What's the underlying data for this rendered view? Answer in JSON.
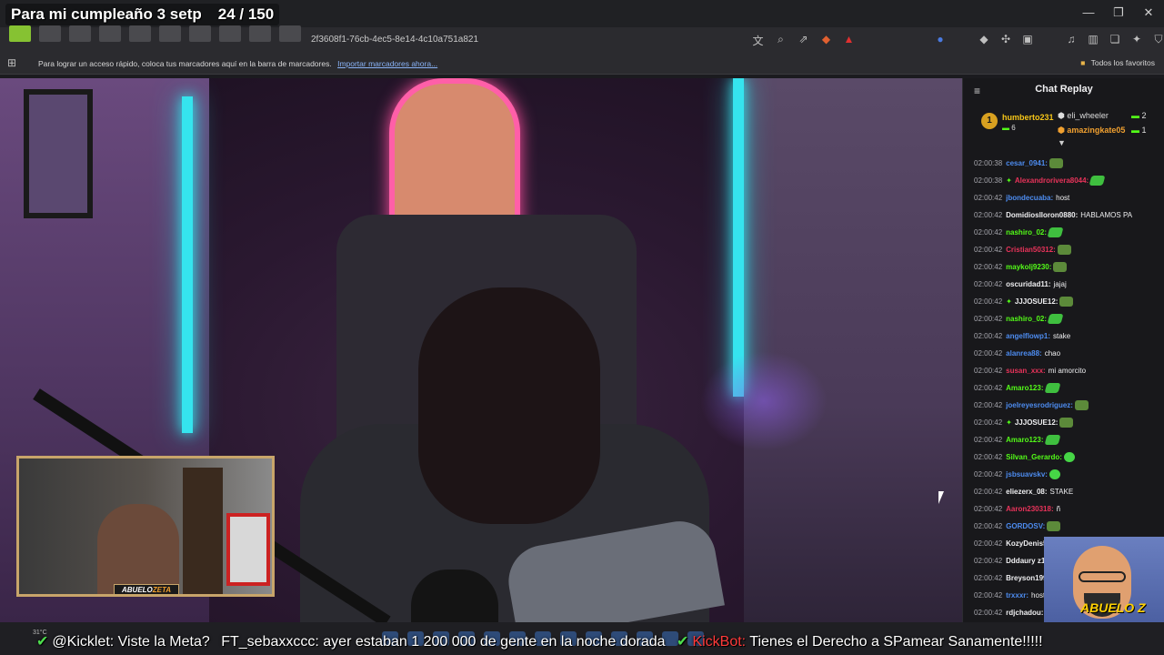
{
  "overlay": {
    "goal_title": "Para mi cumpleaño 3 setp",
    "goal_count": "24 / 150"
  },
  "window": {
    "minimize": "—",
    "maximize": "❐",
    "close": "✕"
  },
  "address": {
    "url_fragment": "2f3608f1-76cb-4ec5-8e14-4c10a751a821"
  },
  "bookmarks": {
    "hint": "Para lograr un acceso rápido, coloca tus marcadores aquí en la barra de marcadores.",
    "import_link": "Importar marcadores ahora...",
    "all_favorites": "Todos los favoritos"
  },
  "webcam": {
    "label_a": "ABUELO",
    "label_b": "ZETA"
  },
  "chat": {
    "title": "Chat Replay",
    "top": [
      {
        "rank": "1",
        "name": "humberto231",
        "count": "6"
      },
      {
        "name": "eli_wheeler",
        "count": "2"
      },
      {
        "name": "amazingkate05",
        "count": "1"
      }
    ],
    "messages": [
      {
        "time": "02:00:38",
        "user": "cesar_0941:",
        "color": "#4d8cf0",
        "text": "",
        "emote": "frog"
      },
      {
        "time": "02:00:38",
        "user": "Alexandrorivera8044:",
        "color": "#e8335a",
        "text": "",
        "emote": "leaf",
        "badge": true
      },
      {
        "time": "02:00:42",
        "user": "jbondecuaba:",
        "color": "#4d8cf0",
        "text": "host"
      },
      {
        "time": "02:00:42",
        "user": "Domidioslloron0880:",
        "color": "#efeff1",
        "text": "HABLAMOS PA"
      },
      {
        "time": "02:00:42",
        "user": "nashiro_02:",
        "color": "#53fc18",
        "text": "",
        "emote": "leaf"
      },
      {
        "time": "02:00:42",
        "user": "Cristian50312:",
        "color": "#e8335a",
        "text": "",
        "emote": "frog"
      },
      {
        "time": "02:00:42",
        "user": "maykolj9230:",
        "color": "#53fc18",
        "text": "",
        "emote": "frog"
      },
      {
        "time": "02:00:42",
        "user": "oscuridad11:",
        "color": "#efeff1",
        "text": "jajaj"
      },
      {
        "time": "02:00:42",
        "user": "JJJOSUE12:",
        "color": "#efeff1",
        "text": "",
        "emote": "frog",
        "badge": true
      },
      {
        "time": "02:00:42",
        "user": "nashiro_02:",
        "color": "#53fc18",
        "text": "",
        "emote": "leaf"
      },
      {
        "time": "02:00:42",
        "user": "angelflowp1:",
        "color": "#4d8cf0",
        "text": "stake"
      },
      {
        "time": "02:00:42",
        "user": "alanrea88:",
        "color": "#4d8cf0",
        "text": "chao"
      },
      {
        "time": "02:00:42",
        "user": "susan_xxx:",
        "color": "#e8335a",
        "text": "mi amorcito"
      },
      {
        "time": "02:00:42",
        "user": "Amaro123:",
        "color": "#53fc18",
        "text": "",
        "emote": "leaf"
      },
      {
        "time": "02:00:42",
        "user": "joelreyesrodriguez:",
        "color": "#4d8cf0",
        "text": "",
        "emote": "frog"
      },
      {
        "time": "02:00:42",
        "user": "JJJOSUE12:",
        "color": "#efeff1",
        "text": "",
        "emote": "frog",
        "badge": true
      },
      {
        "time": "02:00:42",
        "user": "Amaro123:",
        "color": "#53fc18",
        "text": "",
        "emote": "leaf"
      },
      {
        "time": "02:00:42",
        "user": "Silvan_Gerardo:",
        "color": "#53fc18",
        "text": "",
        "emote": "blob"
      },
      {
        "time": "02:00:42",
        "user": "jsbsuavskv:",
        "color": "#4d8cf0",
        "text": "",
        "emote": "blob"
      },
      {
        "time": "02:00:42",
        "user": "eliezerx_08:",
        "color": "#efeff1",
        "text": "STAKE"
      },
      {
        "time": "02:00:42",
        "user": "Aaron230318:",
        "color": "#e8335a",
        "text": "ñ"
      },
      {
        "time": "02:00:42",
        "user": "GORDOSV:",
        "color": "#4d8cf0",
        "text": "",
        "emote": "frog"
      },
      {
        "time": "02:00:42",
        "user": "KozyDenis5",
        "color": "#efeff1",
        "text": ""
      },
      {
        "time": "02:00:42",
        "user": "Dddaury z12",
        "color": "#efeff1",
        "text": ""
      },
      {
        "time": "02:00:42",
        "user": "Breyson199",
        "color": "#efeff1",
        "text": ""
      },
      {
        "time": "02:00:42",
        "user": "trxxxr:",
        "color": "#4d8cf0",
        "text": "host"
      },
      {
        "time": "02:00:42",
        "user": "rdjchadou:",
        "color": "#efeff1",
        "text": ""
      }
    ]
  },
  "avatar": {
    "label": "ABUELO Z"
  },
  "ticker": {
    "weather_temp": "31°C",
    "k_user": "@Kicklet:",
    "k_msg": "Viste la Meta?",
    "u_user": "FT_sebaxxccc:",
    "u_msg": "ayer estaban 1 200 000 de gente en la noche dorada",
    "bot_user": "KickBot:",
    "bot_msg": "Tienes el Derecho a SPamear Sanamente!!!!!"
  }
}
